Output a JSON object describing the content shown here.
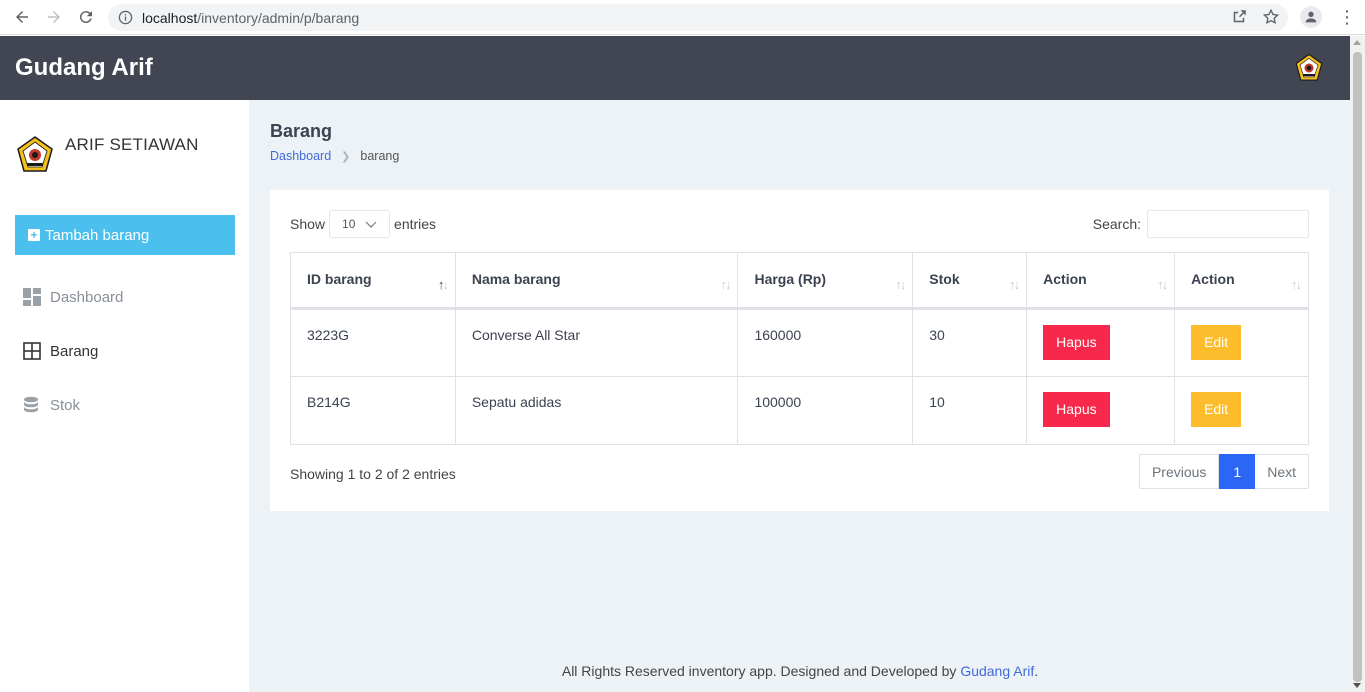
{
  "browser": {
    "url_host": "localhost",
    "url_path": "/inventory/admin/p/barang"
  },
  "app": {
    "brand": "Gudang Arif"
  },
  "sidebar": {
    "user_name": "ARIF SETIAWAN",
    "add_button_label": "Tambah barang",
    "items": [
      {
        "label": "Dashboard",
        "icon": "dashboard-icon"
      },
      {
        "label": "Barang",
        "icon": "grid-icon"
      },
      {
        "label": "Stok",
        "icon": "database-icon"
      }
    ]
  },
  "page": {
    "title": "Barang",
    "breadcrumb": [
      "Dashboard",
      "barang"
    ]
  },
  "table": {
    "show_label": "Show",
    "length_value": "10",
    "entries_label": "entries",
    "search_label": "Search:",
    "columns": [
      "ID barang",
      "Nama barang",
      "Harga (Rp)",
      "Stok",
      "Action",
      "Action"
    ],
    "rows": [
      {
        "id": "3223G",
        "nama": "Converse All Star",
        "harga": "160000",
        "stok": "30",
        "delete": "Hapus",
        "edit": "Edit"
      },
      {
        "id": "B214G",
        "nama": "Sepatu adidas",
        "harga": "100000",
        "stok": "10",
        "delete": "Hapus",
        "edit": "Edit"
      }
    ],
    "info": "Showing 1 to 2 of 2 entries",
    "pagination": {
      "previous": "Previous",
      "current": "1",
      "next": "Next"
    }
  },
  "footer": {
    "text": "All Rights Reserved inventory app. Designed and Developed by ",
    "link": "Gudang Arif",
    "suffix": "."
  },
  "colors": {
    "header_bg": "#414652",
    "add_button": "#4bbfed",
    "delete_button": "#f7284b",
    "edit_button": "#fdbc2c",
    "page_active": "#2c66f5",
    "link": "#3f6ad8",
    "content_bg": "#edf2f6"
  }
}
